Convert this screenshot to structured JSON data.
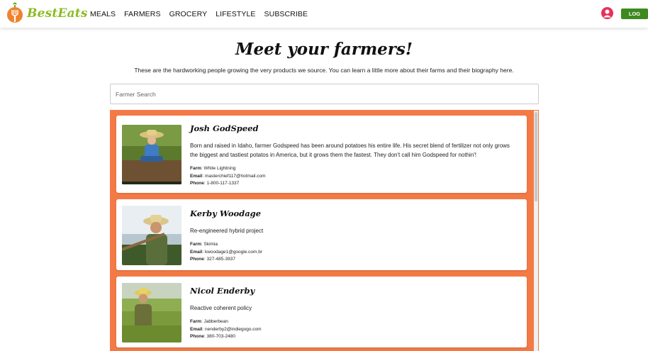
{
  "brand": {
    "name": "BestEats",
    "logo_icon": "carrot-fork-logo",
    "accent": "#8dbb21"
  },
  "nav": [
    "MEALS",
    "FARMERS",
    "GROCERY",
    "LIFESTYLE",
    "SUBSCRIBE"
  ],
  "header": {
    "user_icon": "user-avatar-icon",
    "logout_label": "LOG OUT"
  },
  "page": {
    "title": "Meet your farmers!",
    "subtitle": "These are the hardworking people growing the very products we source. You can learn a little more about their farms and their biography here."
  },
  "search": {
    "placeholder": "Farmer Search",
    "value": ""
  },
  "labels": {
    "farm": "Farm",
    "email": "Email",
    "phone": "Phone"
  },
  "colors": {
    "list_bg": "#f47a45",
    "logout_bg": "#3d8a1e",
    "user_icon": "#e8305c"
  },
  "farmers": [
    {
      "name": "Josh GodSpeed",
      "bio": "Born and raised in Idaho, farmer Godspeed has been around potatoes his entire life. His secret blend of fertilizer not only grows the biggest and tastiest potatos in America, but it grows them the fastest. They don't call him Godspeed for nothin'!",
      "farm": "White Lightning",
      "email": "masterchief117@hotmail.com",
      "phone": "1-800-117-1337"
    },
    {
      "name": "Kerby Woodage",
      "bio": "Re-engineered hybrid project",
      "farm": "Skimia",
      "email": "kwoodage1@google.com.br",
      "phone": "327-485-3937"
    },
    {
      "name": "Nicol Enderby",
      "bio": "Reactive coherent policy",
      "farm": "Jabberbean",
      "email": "nenderby2@indiegogo.com",
      "phone": "380-703-2480"
    }
  ]
}
